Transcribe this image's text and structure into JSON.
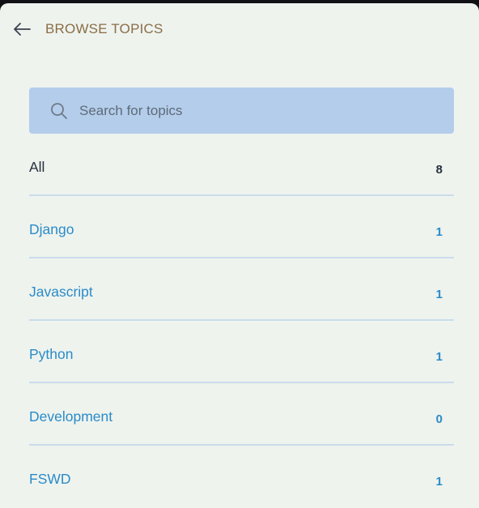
{
  "header": {
    "back_icon": "arrow-left-icon",
    "title": "BROWSE TOPICS"
  },
  "search": {
    "icon": "search-icon",
    "placeholder": "Search for topics",
    "value": ""
  },
  "topics": [
    {
      "label": "All",
      "count": "8"
    },
    {
      "label": "Django",
      "count": "1"
    },
    {
      "label": "Javascript",
      "count": "1"
    },
    {
      "label": "Python",
      "count": "1"
    },
    {
      "label": "Development",
      "count": "0"
    },
    {
      "label": "FSWD",
      "count": "1"
    }
  ],
  "colors": {
    "panel_bg": "#eef3ee",
    "title": "#8a6d46",
    "search_bg": "#b3cdeb",
    "link": "#2b8bc8",
    "divider": "#c9dceb",
    "all_text": "#27313d"
  }
}
